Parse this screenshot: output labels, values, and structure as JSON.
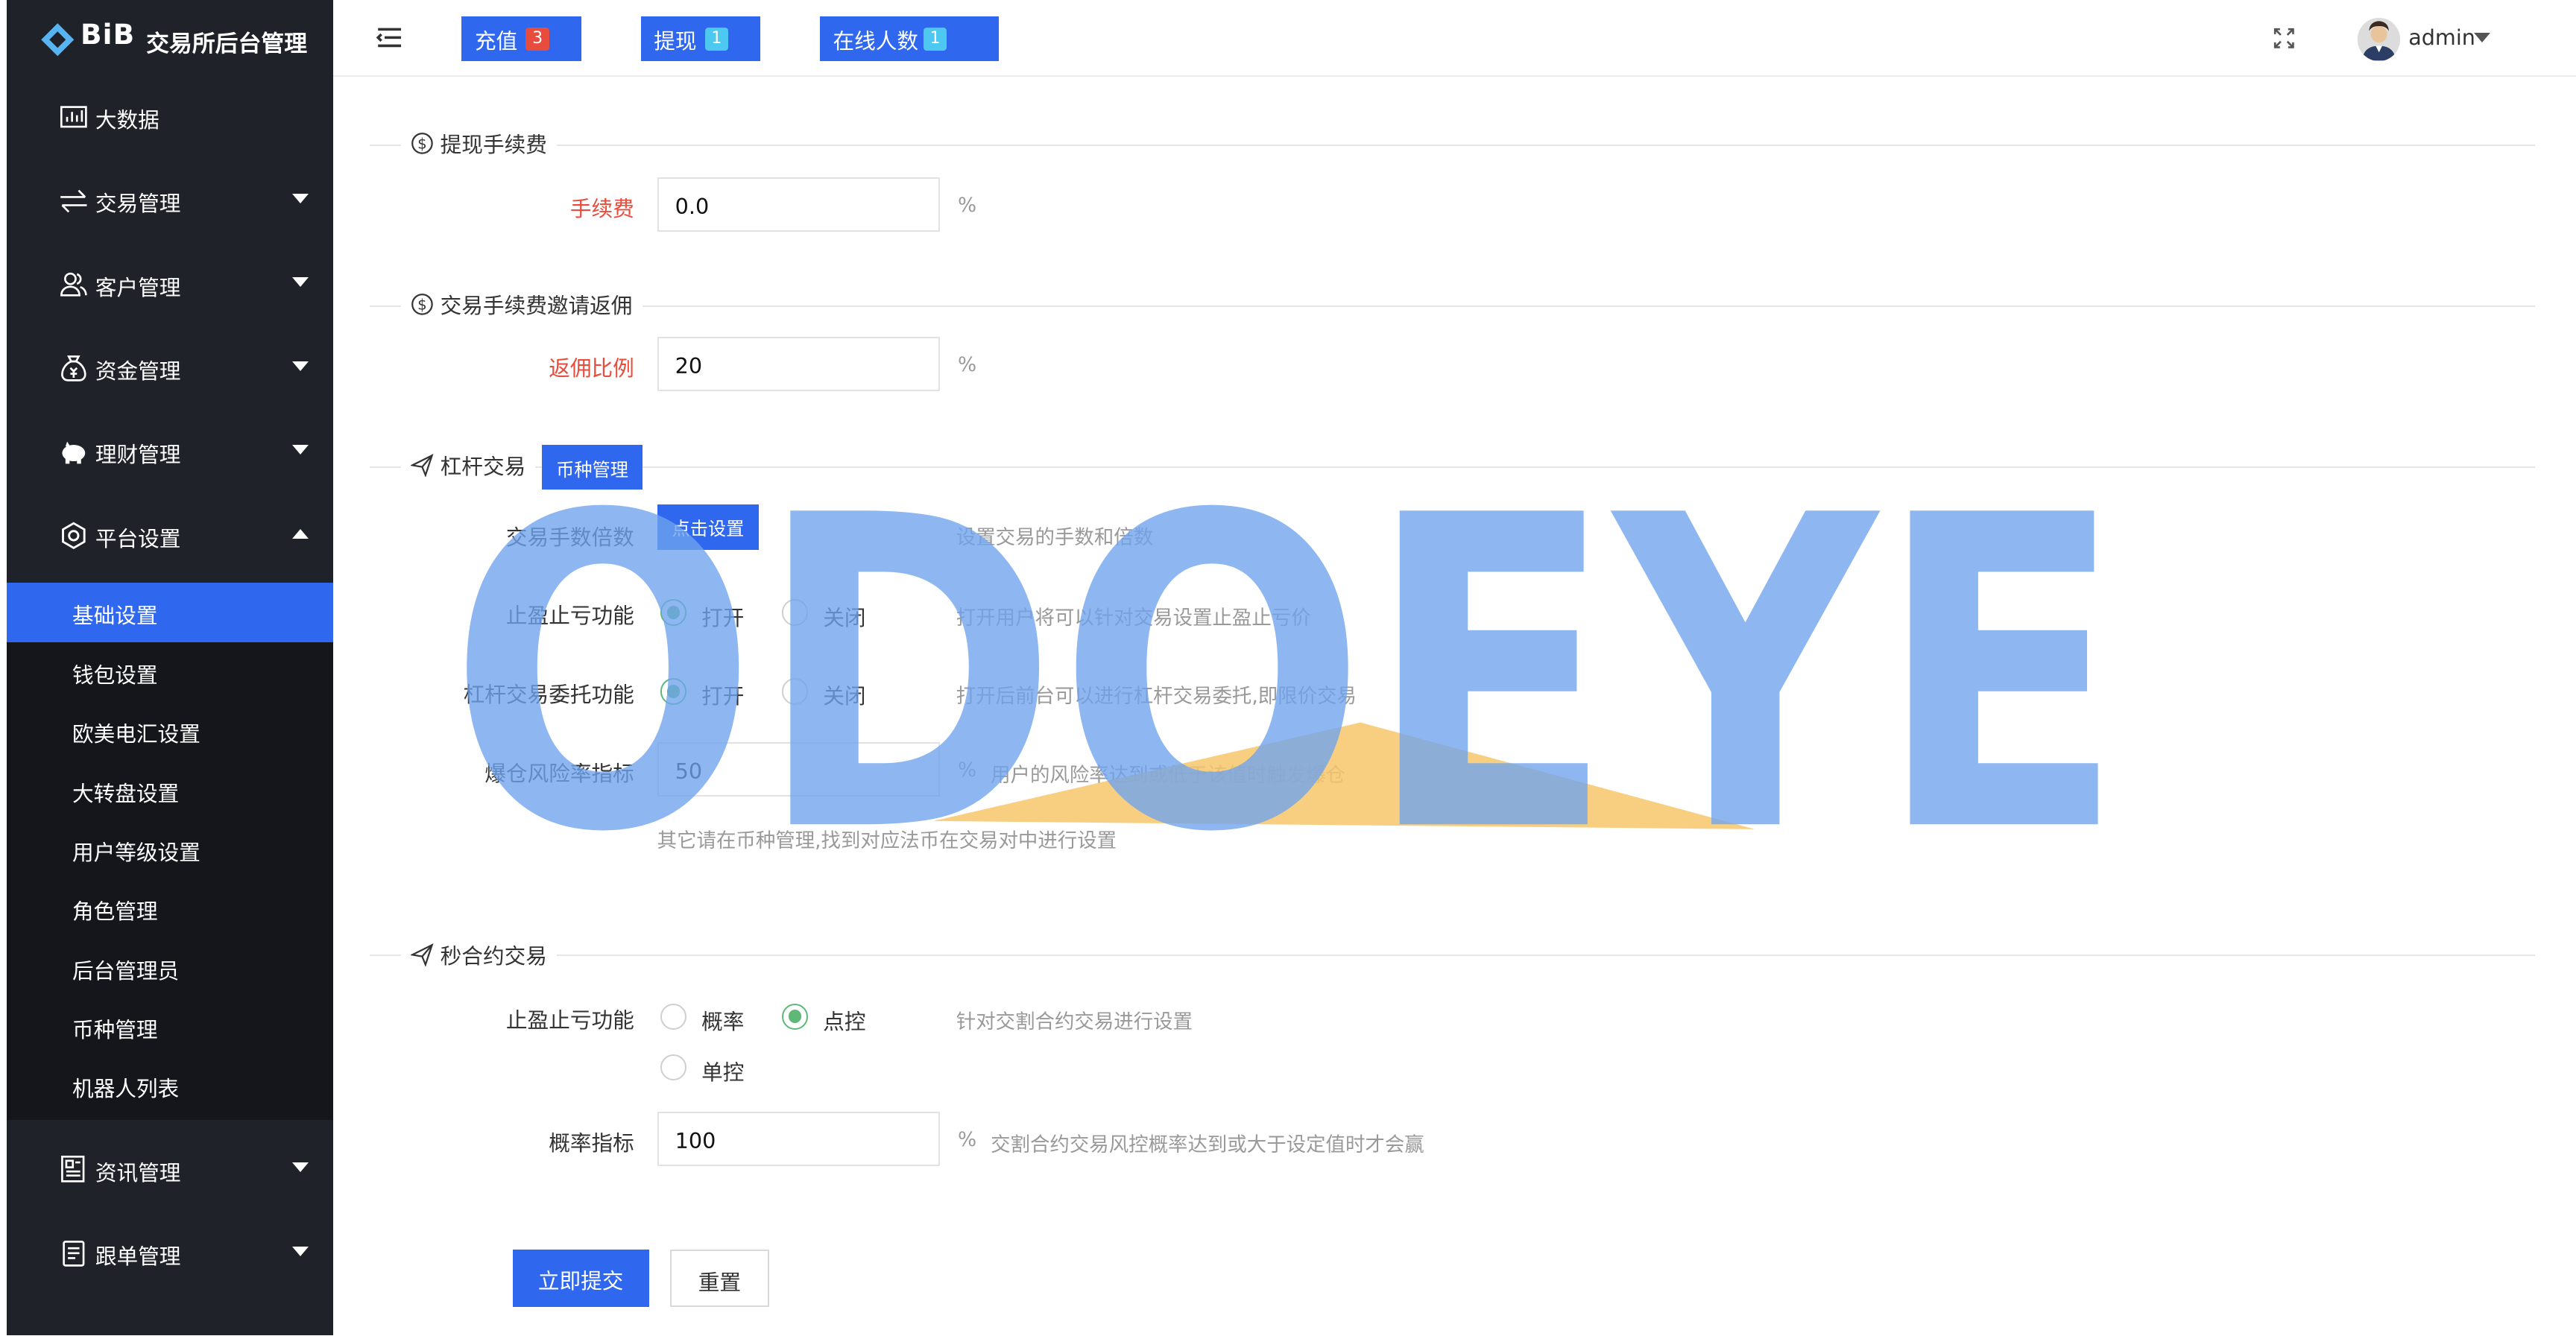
{
  "app": {
    "logo_text": "BiB",
    "title": "交易所后台管理"
  },
  "sidebar": {
    "items": [
      {
        "label": "大数据",
        "icon": "chart-icon"
      },
      {
        "label": "交易管理",
        "icon": "exchange-icon"
      },
      {
        "label": "客户管理",
        "icon": "users-icon"
      },
      {
        "label": "资金管理",
        "icon": "money-bag-icon"
      },
      {
        "label": "理财管理",
        "icon": "piggy-bank-icon"
      },
      {
        "label": "平台设置",
        "icon": "settings-icon",
        "expanded": true
      },
      {
        "label": "资讯管理",
        "icon": "news-icon"
      },
      {
        "label": "跟单管理",
        "icon": "document-icon"
      }
    ],
    "submenu": [
      {
        "label": "基础设置",
        "active": true
      },
      {
        "label": "钱包设置"
      },
      {
        "label": "欧美电汇设置"
      },
      {
        "label": "大转盘设置"
      },
      {
        "label": "用户等级设置"
      },
      {
        "label": "角色管理"
      },
      {
        "label": "后台管理员"
      },
      {
        "label": "币种管理"
      },
      {
        "label": "机器人列表"
      }
    ]
  },
  "header": {
    "recharge": {
      "label": "充值",
      "count": "3",
      "badge_color": "#e84c3d"
    },
    "withdraw": {
      "label": "提现",
      "count": "1",
      "badge_color": "#4dc8f0"
    },
    "online": {
      "label": "在线人数",
      "count": "1",
      "badge_color": "#4dc8f0"
    },
    "user": "admin"
  },
  "sections": {
    "withdraw_fee": {
      "title": "提现手续费",
      "fee_label": "手续费",
      "fee_value": "0.0",
      "unit": "%"
    },
    "rebate": {
      "title": "交易手续费邀请返佣",
      "ratio_label": "返佣比例",
      "ratio_value": "20",
      "unit": "%"
    },
    "leverage": {
      "title": "杠杆交易",
      "coin_manage_btn": "币种管理",
      "multiplier_label": "交易手数倍数",
      "multiplier_btn": "点击设置",
      "multiplier_hint": "设置交易的手数和倍数",
      "tpsl_label": "止盈止亏功能",
      "tpsl_on": "打开",
      "tpsl_off": "关闭",
      "tpsl_hint": "打开用户将可以针对交易设置止盈止亏价",
      "entrust_label": "杠杆交易委托功能",
      "entrust_on": "打开",
      "entrust_off": "关闭",
      "entrust_hint": "打开后前台可以进行杠杆交易委托,即限价交易",
      "risk_label": "爆仓风险率指标",
      "risk_value": "50",
      "risk_unit": "%",
      "risk_hint": "用户的风险率达到或低于该值时触发爆仓",
      "other_note": "其它请在币种管理,找到对应法币在交易对中进行设置"
    },
    "second_contract": {
      "title": "秒合约交易",
      "tpsl_label": "止盈止亏功能",
      "opt_probability": "概率",
      "opt_point": "点控",
      "opt_single": "单控",
      "tpsl_hint": "针对交割合约交易进行设置",
      "prob_label": "概率指标",
      "prob_value": "100",
      "prob_unit": "%",
      "prob_hint": "交割合约交易风控概率达到或大于设定值时才会赢"
    }
  },
  "actions": {
    "submit": "立即提交",
    "reset": "重置"
  },
  "watermark": "ODOEYE",
  "colors": {
    "primary": "#2f67ee",
    "sidebar_bg": "#20222a",
    "submenu_bg": "#14161c",
    "radio_on": "#5fb878",
    "required_label": "#e84c3d"
  }
}
